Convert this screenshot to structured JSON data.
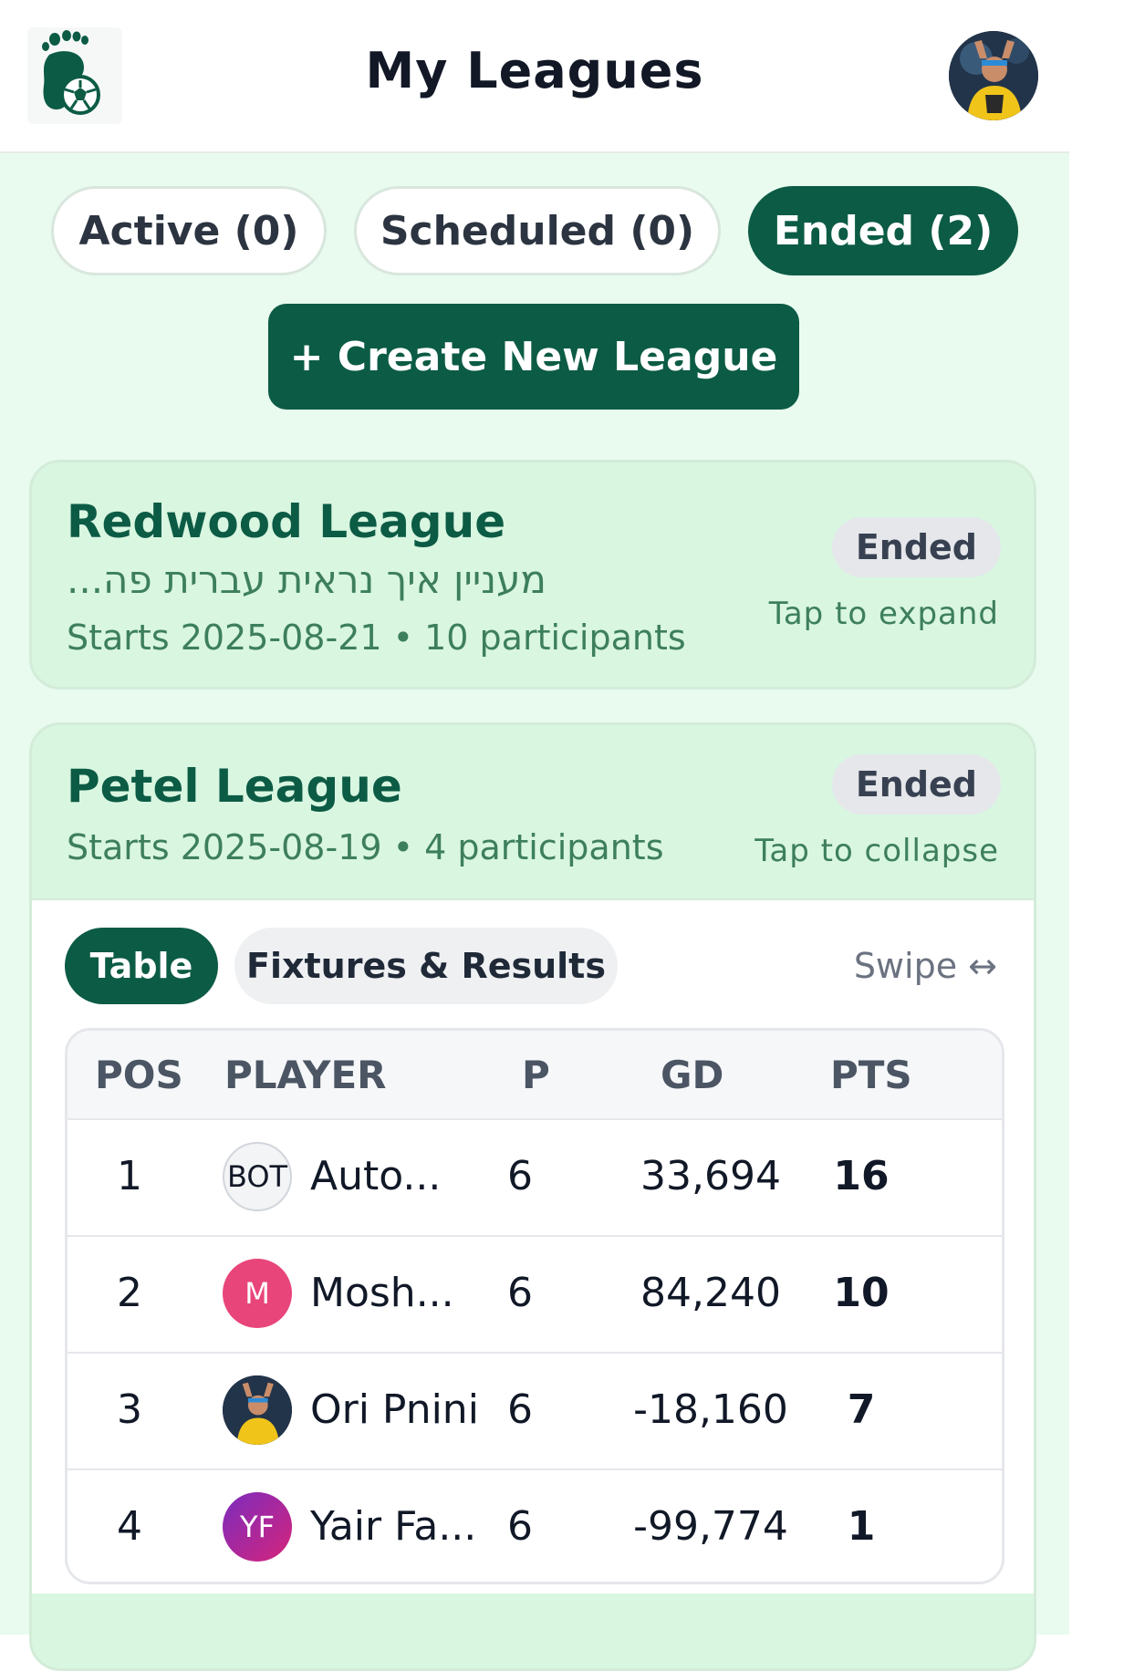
{
  "header": {
    "title": "My Leagues",
    "logo_icon": "footprint-soccer-ball-logo",
    "avatar_icon": "user-avatar-photo"
  },
  "filters": [
    {
      "label": "Active (0)",
      "selected": false
    },
    {
      "label": "Scheduled (0)",
      "selected": false
    },
    {
      "label": "Ended (2)",
      "selected": true
    }
  ],
  "create_button": {
    "label": "+ Create New League"
  },
  "leagues": [
    {
      "name": "Redwood League",
      "description": "מעניין איך נראית עברית פה...",
      "meta": "Starts 2025-08-21 • 10 participants",
      "status": "Ended",
      "hint": "Tap to expand"
    },
    {
      "name": "Petel League",
      "meta": "Starts 2025-08-19 • 4 participants",
      "status": "Ended",
      "hint": "Tap to collapse",
      "tabs": [
        {
          "label": "Table",
          "selected": true
        },
        {
          "label": "Fixtures & Results",
          "selected": false
        }
      ],
      "swipe_hint": "Swipe ↔",
      "table": {
        "headers": [
          "POS",
          "PLAYER",
          "P",
          "GD",
          "PTS"
        ],
        "rows": [
          {
            "pos": "1",
            "avatar": "BOT",
            "player": "Auto...",
            "p": "6",
            "gd": "33,694",
            "pts": "16"
          },
          {
            "pos": "2",
            "avatar": "M",
            "player": "Mosh...",
            "p": "6",
            "gd": "84,240",
            "pts": "10"
          },
          {
            "pos": "3",
            "avatar": "",
            "player": "Ori Pnini",
            "p": "6",
            "gd": "-18,160",
            "pts": "7"
          },
          {
            "pos": "4",
            "avatar": "YF",
            "player": "Yair Fa...",
            "p": "6",
            "gd": "-99,774",
            "pts": "1"
          }
        ]
      }
    }
  ],
  "colors": {
    "brand": "#0c5b45",
    "background": "#e8fbee",
    "card": "#d9f6e1",
    "avatar_m": "#e8457a",
    "avatar_yf": "#a0239c"
  }
}
